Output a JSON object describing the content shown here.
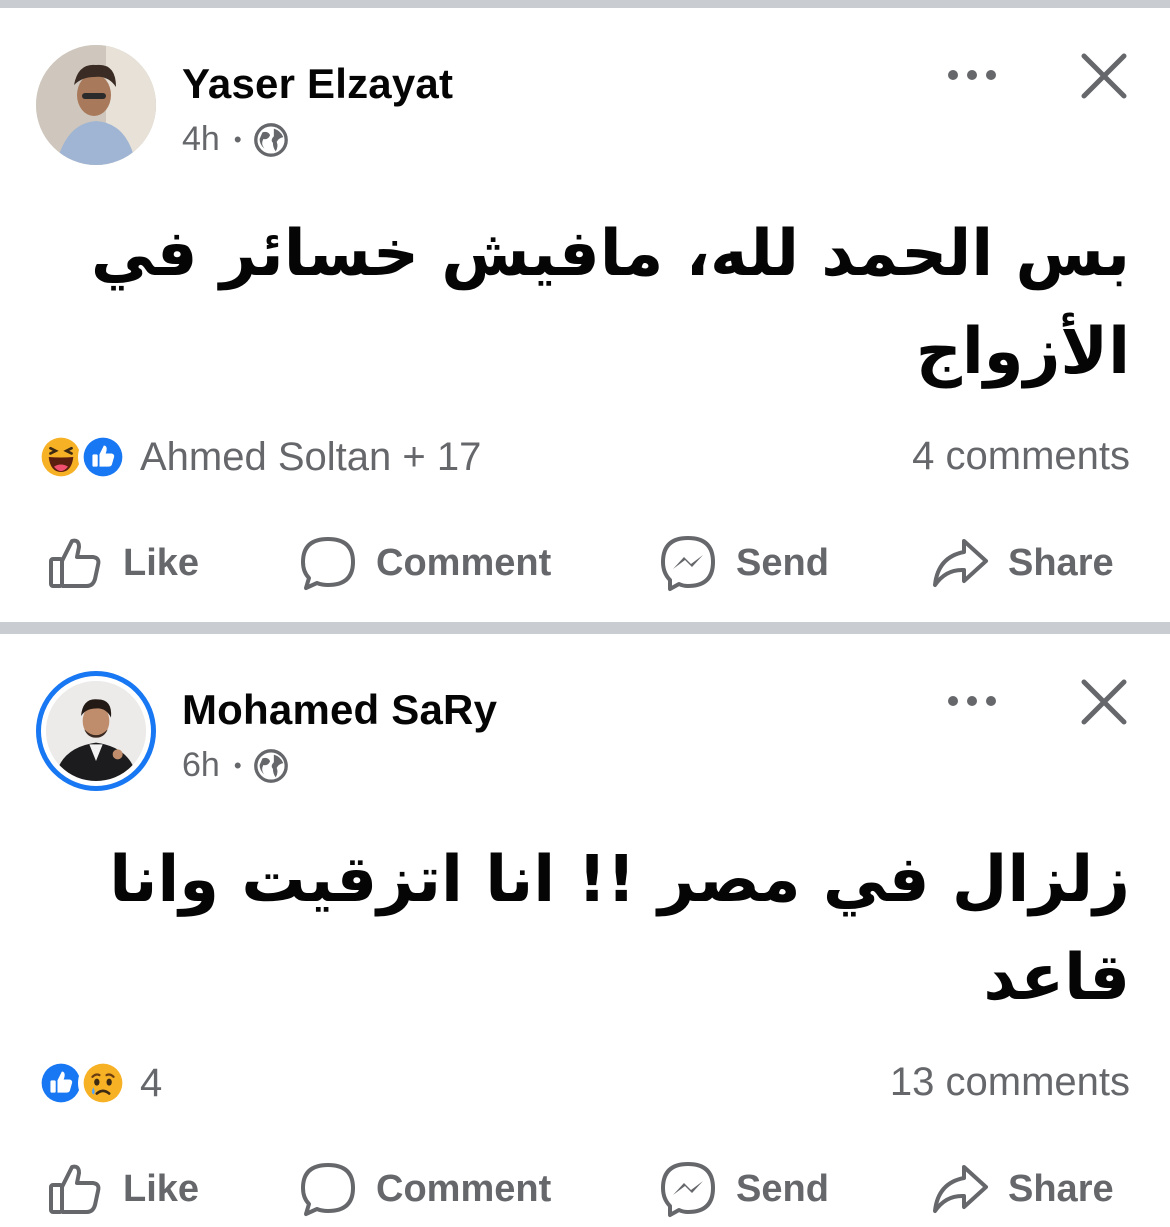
{
  "posts": [
    {
      "author": "Yaser Elzayat",
      "time": "4h",
      "body_line1": "بس الحمد لله، مافيش خسائر في",
      "body_line2": "الأزواج",
      "reactions_text": "Ahmed Soltan + 17",
      "reaction_icons": [
        "haha-icon",
        "like-icon"
      ],
      "comments": "4 comments"
    },
    {
      "author": "Mohamed SaRy",
      "time": "6h",
      "body_line1": "زلزال في مصر !! انا اتزقيت وانا",
      "body_line2": "قاعد",
      "reactions_text": "4",
      "reaction_icons": [
        "like-icon",
        "sad-icon"
      ],
      "comments": "13 comments"
    }
  ],
  "actions": {
    "like": "Like",
    "comment": "Comment",
    "send": "Send",
    "share": "Share"
  },
  "colors": {
    "accent": "#1877f2",
    "secondary_text": "#65676b",
    "divider": "#c9ccd1"
  }
}
